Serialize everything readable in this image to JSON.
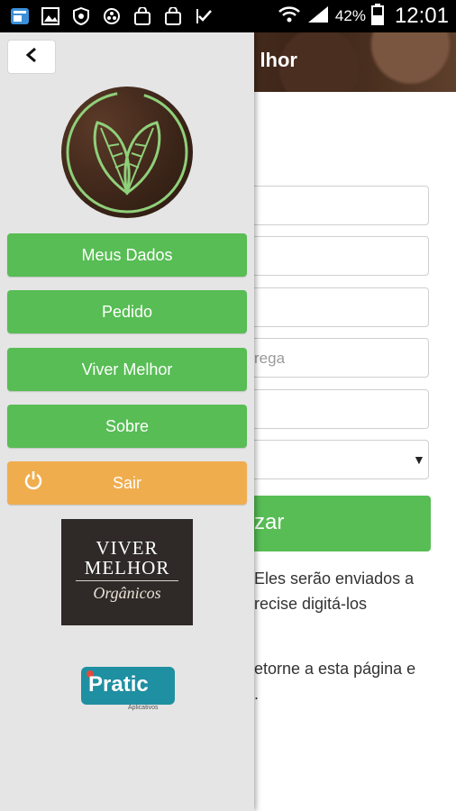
{
  "status_bar": {
    "battery_percent": "42%",
    "time": "12:01"
  },
  "page": {
    "title_partial": "lhor",
    "field_placeholder_partial": "rega",
    "action_button_partial": "zar",
    "text_lines": [
      "Eles serão enviados a",
      "recise digitá-los",
      "etorne a esta página e",
      "."
    ]
  },
  "drawer": {
    "back_icon": "chevron-left-icon",
    "menu": [
      {
        "label": "Meus Dados"
      },
      {
        "label": "Pedido"
      },
      {
        "label": "Viver Melhor"
      },
      {
        "label": "Sobre"
      }
    ],
    "logout": {
      "label": "Sair",
      "icon": "power-icon"
    },
    "brand": {
      "line1": "VIVER",
      "line2": "MELHOR",
      "line3": "Orgânicos"
    },
    "pratic": {
      "name": "Pratic",
      "sub": "Aplicativos"
    }
  },
  "colors": {
    "green": "#57bd54",
    "orange": "#f0ad4e",
    "drawer_bg": "#e5e5e5",
    "pratic_teal": "#1f8fa2"
  }
}
